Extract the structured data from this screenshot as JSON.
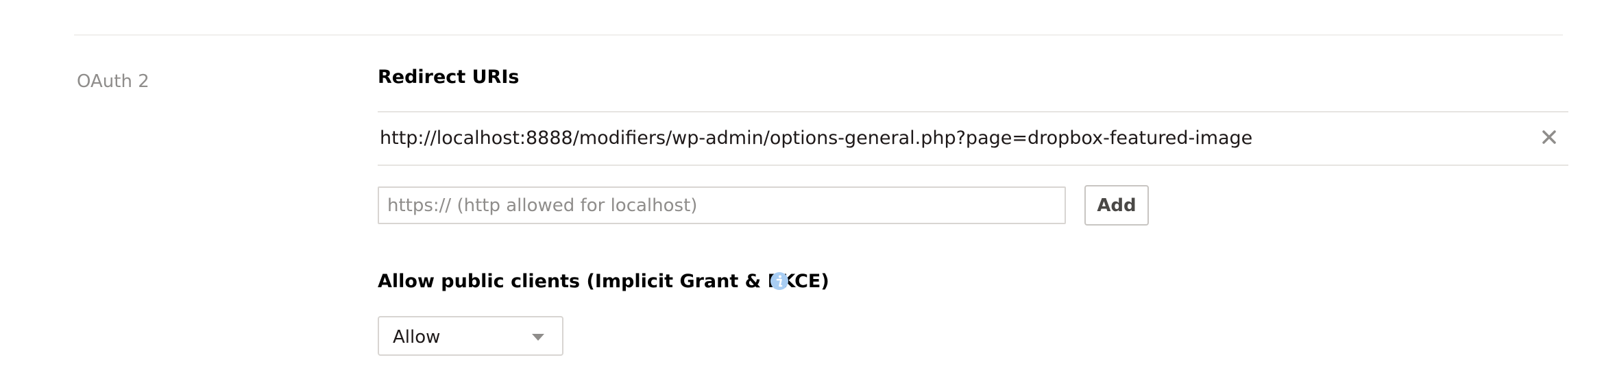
{
  "section": {
    "label": "OAuth 2"
  },
  "redirect_uris": {
    "title": "Redirect URIs",
    "items": [
      "http://localhost:8888/modifiers/wp-admin/options-general.php?page=dropbox-featured-image"
    ],
    "remove_icon": "close-icon",
    "input_value": "",
    "input_placeholder": "https:// (http allowed for localhost)",
    "add_label": "Add"
  },
  "public_clients": {
    "title": "Allow public clients (Implicit Grant & PKCE)",
    "info_icon": "info-icon",
    "selected_option": "Allow"
  },
  "colors": {
    "info_icon": "#a8cdf3",
    "muted_text": "#8f8d8b",
    "divider": "#e6e4e1"
  }
}
